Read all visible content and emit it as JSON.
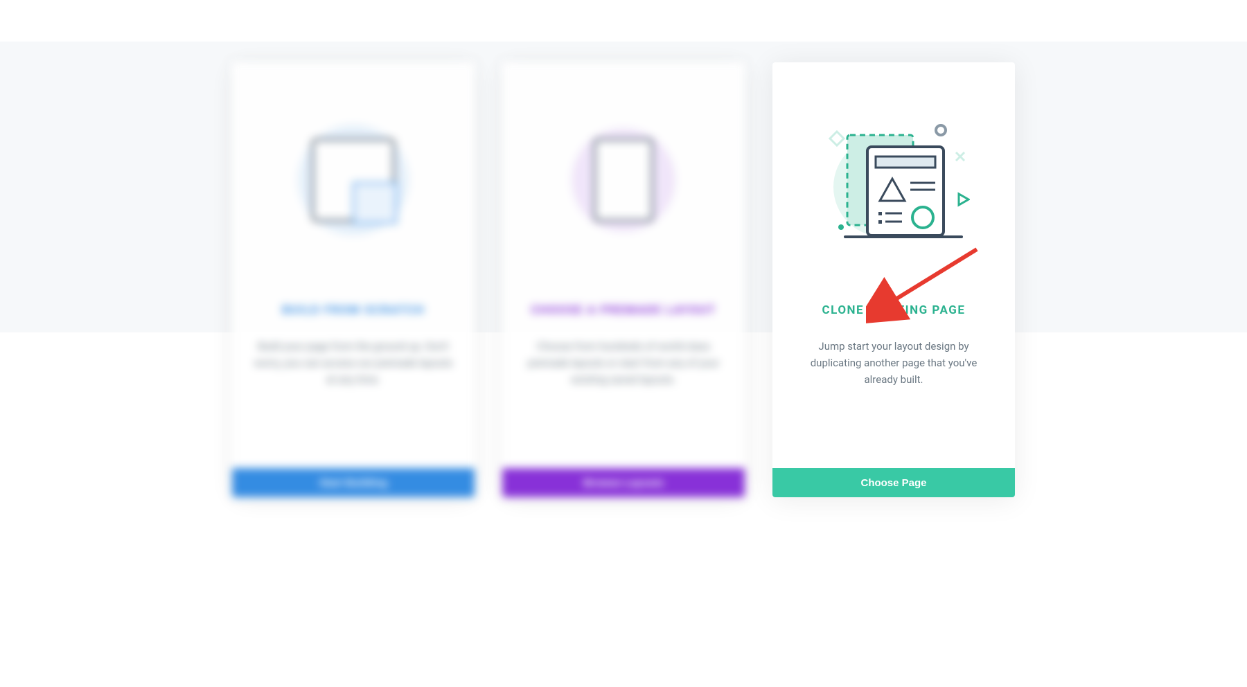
{
  "cards": [
    {
      "title": "BUILD FROM SCRATCH",
      "description": "Build your page from the ground up. Don't worry, you can access our premade layouts at any time.",
      "button": "Start Building",
      "accent": "#2a86e1"
    },
    {
      "title": "CHOOSE A PREMADE LAYOUT",
      "description": "Choose from hundreds of world-class premade layouts or start from any of your existing saved layouts.",
      "button": "Browse Layouts",
      "accent": "#8227d6"
    },
    {
      "title": "CLONE EXISTING PAGE",
      "description": "Jump start your layout design by duplicating another page that you've already built.",
      "button": "Choose Page",
      "accent": "#2bb28f"
    }
  ]
}
